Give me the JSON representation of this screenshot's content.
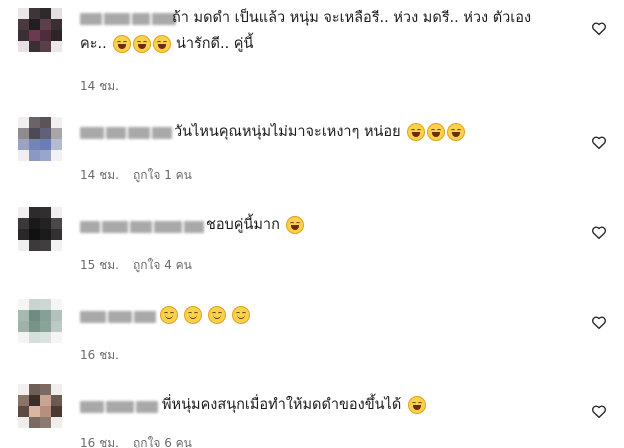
{
  "comments": [
    {
      "text_line1": "ถ้า มดดำ เป็นแล้ว หนุ่ม จะเหลือรี.. ห่วง มดรี.. ห่วง ตัวเอง",
      "text_line2_prefix": "คะ..",
      "text_line2_suffix": "น่ารักดี.. คู่นี้",
      "time": "14 ชม.",
      "likes": ""
    },
    {
      "text_line1": "วันไหนคุณหนุ่มไม่มาจะเหงาๆ หน่อย",
      "time": "14 ชม.",
      "likes": "ถูกใจ 1 คน"
    },
    {
      "text_line1": "ชอบคู่นี้มาก",
      "time": "15 ชม.",
      "likes": "ถูกใจ 4 คน"
    },
    {
      "text_line1": "",
      "time": "16 ชม.",
      "likes": ""
    },
    {
      "text_line1": "พี่หนุ่มคงสนุกเมื่อทำให้มดดำของขึ้นได้",
      "time": "16 ชม.",
      "likes": "ถูกใจ 6 คน"
    }
  ],
  "icons": {
    "heart": "heart-outline-icon",
    "laugh": "grinning-sweat-emoji",
    "blush": "smiling-blush-emoji"
  },
  "colors": {
    "text": "#1a1a1a",
    "meta": "#6b6b6b",
    "emoji": "#fbd14b"
  }
}
